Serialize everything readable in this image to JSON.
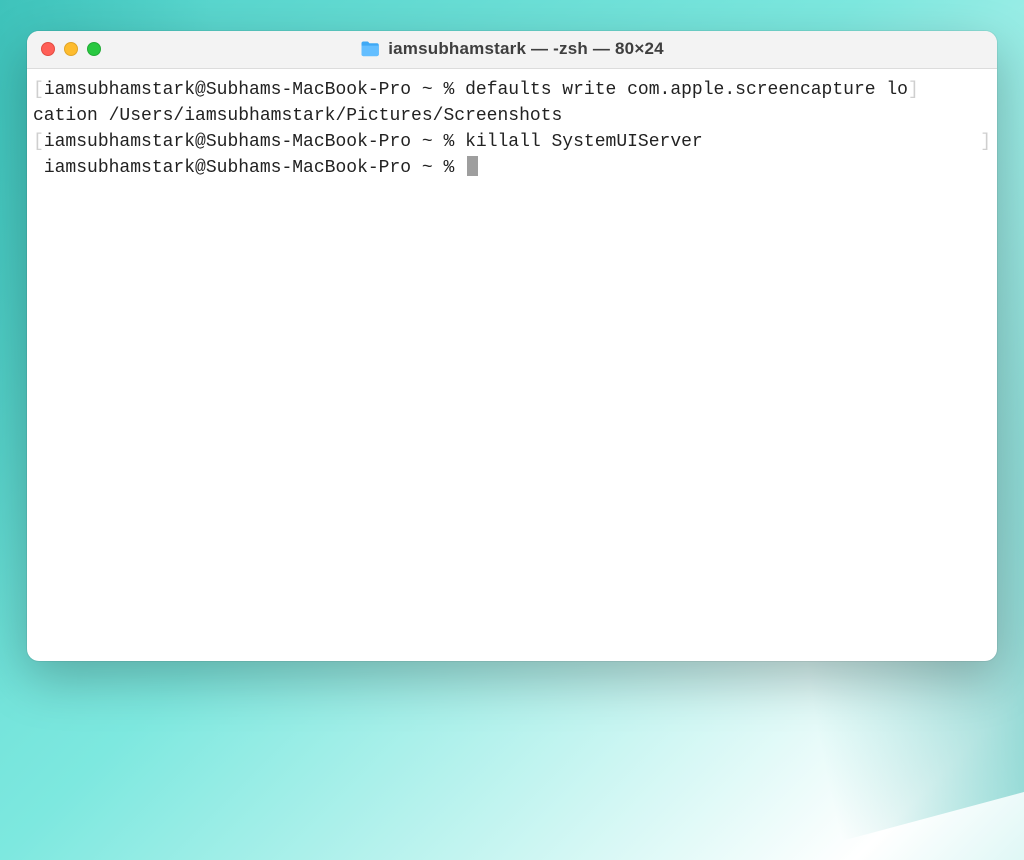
{
  "window": {
    "title": "iamsubhamstark — -zsh — 80×24"
  },
  "terminal": {
    "lines": [
      {
        "open_bracket": "[",
        "prompt": "iamsubhamstark@Subhams-MacBook-Pro ~ % ",
        "command": "defaults write com.apple.screencapture lo",
        "close_bracket": "]"
      },
      {
        "continuation": "cation /Users/iamsubhamstark/Pictures/Screenshots"
      },
      {
        "open_bracket": "[",
        "prompt": "iamsubhamstark@Subhams-MacBook-Pro ~ % ",
        "command": "killall SystemUIServer",
        "close_bracket": "]"
      },
      {
        "prompt": "iamsubhamstark@Subhams-MacBook-Pro ~ % ",
        "cursor": true
      }
    ]
  }
}
